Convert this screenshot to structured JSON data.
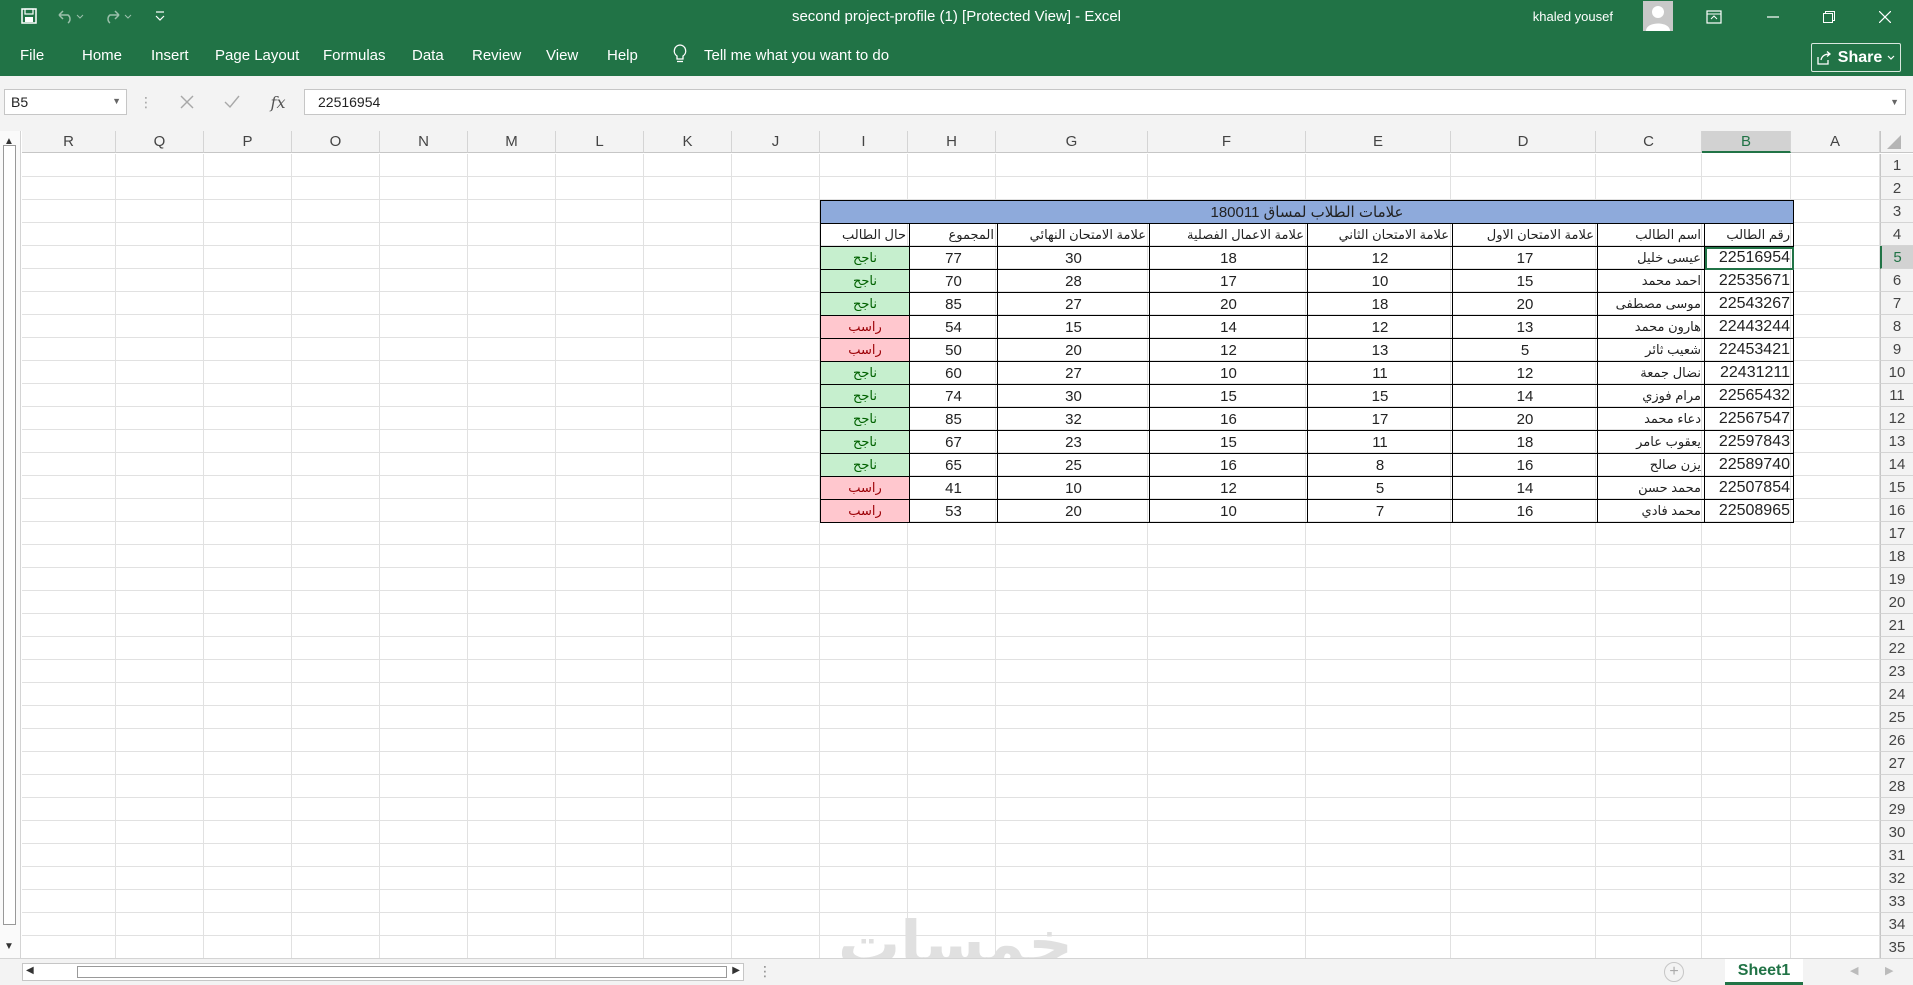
{
  "window": {
    "title": "second project-profile (1)  [Protected View]  -  Excel",
    "user": "khaled yousef"
  },
  "ribbon": {
    "tabs": [
      "File",
      "Home",
      "Insert",
      "Page Layout",
      "Formulas",
      "Data",
      "Review",
      "View",
      "Help"
    ],
    "tell_me": "Tell me what you want to do",
    "share": "Share"
  },
  "formula_bar": {
    "name_box": "B5",
    "fx": "fx",
    "value": "22516954"
  },
  "columns": [
    "R",
    "Q",
    "P",
    "O",
    "N",
    "M",
    "L",
    "K",
    "J",
    "I",
    "H",
    "G",
    "F",
    "E",
    "D",
    "C",
    "B",
    "A"
  ],
  "selected_column": "B",
  "rows": [
    "1",
    "2",
    "3",
    "4",
    "5",
    "6",
    "7",
    "8",
    "9",
    "10",
    "11",
    "12",
    "13",
    "14",
    "15",
    "16",
    "17",
    "18",
    "19",
    "20",
    "21",
    "22",
    "23",
    "24",
    "25",
    "26",
    "27",
    "28",
    "29",
    "30",
    "31",
    "32",
    "33",
    "34",
    "35"
  ],
  "selected_row": "5",
  "table": {
    "title": "علامات الطلاب لمساق 180011",
    "headers": [
      "رقم الطالب",
      "اسم الطالب",
      "علامة الامتحان الاول",
      "علامة الامتحان الثاني",
      "علامة الاعمال الفصلية",
      "علامة الامتحان النهائي",
      "المجموع",
      "حال الطالب"
    ],
    "rows": [
      {
        "id": "22516954",
        "name": "عيسى خليل",
        "first": "17",
        "second": "12",
        "coursework": "18",
        "final": "30",
        "total": "77",
        "status": "ناجح",
        "pass": true
      },
      {
        "id": "22535671",
        "name": "احمد محمد",
        "first": "15",
        "second": "10",
        "coursework": "17",
        "final": "28",
        "total": "70",
        "status": "ناجح",
        "pass": true
      },
      {
        "id": "22543267",
        "name": "موسى مصطفى",
        "first": "20",
        "second": "18",
        "coursework": "20",
        "final": "27",
        "total": "85",
        "status": "ناجح",
        "pass": true
      },
      {
        "id": "22443244",
        "name": "هارون محمد",
        "first": "13",
        "second": "12",
        "coursework": "14",
        "final": "15",
        "total": "54",
        "status": "راسب",
        "pass": false
      },
      {
        "id": "22453421",
        "name": "شعيب ثائر",
        "first": "5",
        "second": "13",
        "coursework": "12",
        "final": "20",
        "total": "50",
        "status": "راسب",
        "pass": false
      },
      {
        "id": "22431211",
        "name": "نضال جمعة",
        "first": "12",
        "second": "11",
        "coursework": "10",
        "final": "27",
        "total": "60",
        "status": "ناجح",
        "pass": true
      },
      {
        "id": "22565432",
        "name": "مرام فوزي",
        "first": "14",
        "second": "15",
        "coursework": "15",
        "final": "30",
        "total": "74",
        "status": "ناجح",
        "pass": true
      },
      {
        "id": "22567547",
        "name": "دعاء محمد",
        "first": "20",
        "second": "17",
        "coursework": "16",
        "final": "32",
        "total": "85",
        "status": "ناجح",
        "pass": true
      },
      {
        "id": "22597843",
        "name": "يعقوب عامر",
        "first": "18",
        "second": "11",
        "coursework": "15",
        "final": "23",
        "total": "67",
        "status": "ناجح",
        "pass": true
      },
      {
        "id": "22589740",
        "name": "يزن صالح",
        "first": "16",
        "second": "8",
        "coursework": "16",
        "final": "25",
        "total": "65",
        "status": "ناجح",
        "pass": true
      },
      {
        "id": "22507854",
        "name": "محمد حسن",
        "first": "14",
        "second": "5",
        "coursework": "12",
        "final": "10",
        "total": "41",
        "status": "راسب",
        "pass": false
      },
      {
        "id": "22508965",
        "name": "محمد فادي",
        "first": "16",
        "second": "7",
        "coursework": "10",
        "final": "20",
        "total": "53",
        "status": "راسب",
        "pass": false
      }
    ]
  },
  "watermark": "خمسات",
  "sheet_tab": "Sheet1",
  "colors": {
    "accent": "#217346",
    "title_fill": "#8eaadb",
    "pass_fill": "#c6efce",
    "pass_text": "#006100",
    "fail_fill": "#ffc7ce",
    "fail_text": "#9c0006"
  }
}
